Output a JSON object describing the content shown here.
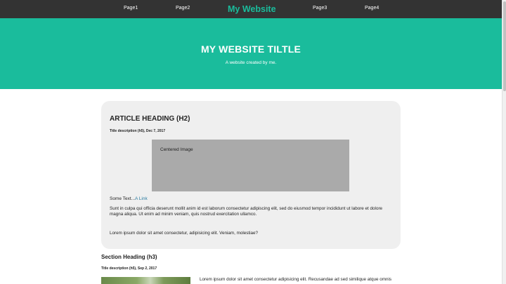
{
  "nav": {
    "links": [
      "Page1",
      "Page2",
      "Page3",
      "Page4"
    ],
    "brand": "My Website"
  },
  "hero": {
    "title": "MY WEBSITE TILTLE",
    "subtitle": "A website created by me."
  },
  "article": {
    "heading": "ARTICLE HEADING (H2)",
    "description": "Title description (h5), Dec 7, 2017",
    "image_label": "Centered Image",
    "some_text": "Some Text...",
    "link_text": "A Link",
    "paragraph1": "Sunt in culpa qui officia deserunt mollit anim id est laborum consectetur adipiscing elit, sed do eiusmod tempor incididunt ut labore et dolore magna aliqua. Ut enim ad minim veniam, quis nostrud exercitation ullamco.",
    "paragraph2": "Lorem ipsum dolor sit amet consectetur, adipisicing elit. Veniam, molestiae?"
  },
  "section": {
    "heading": "Section Heading (h3)",
    "description": "Title description (h5), Sep 2, 2017",
    "text": "Lorem ipsum dolor sit amet consectetur adipisicing elit. Recusandae ad sed similique atque omnis"
  },
  "colors": {
    "accent": "#1abc9c",
    "nav_bg": "#333333",
    "card_bg": "#efefef",
    "image_placeholder": "#aaaaaa"
  }
}
